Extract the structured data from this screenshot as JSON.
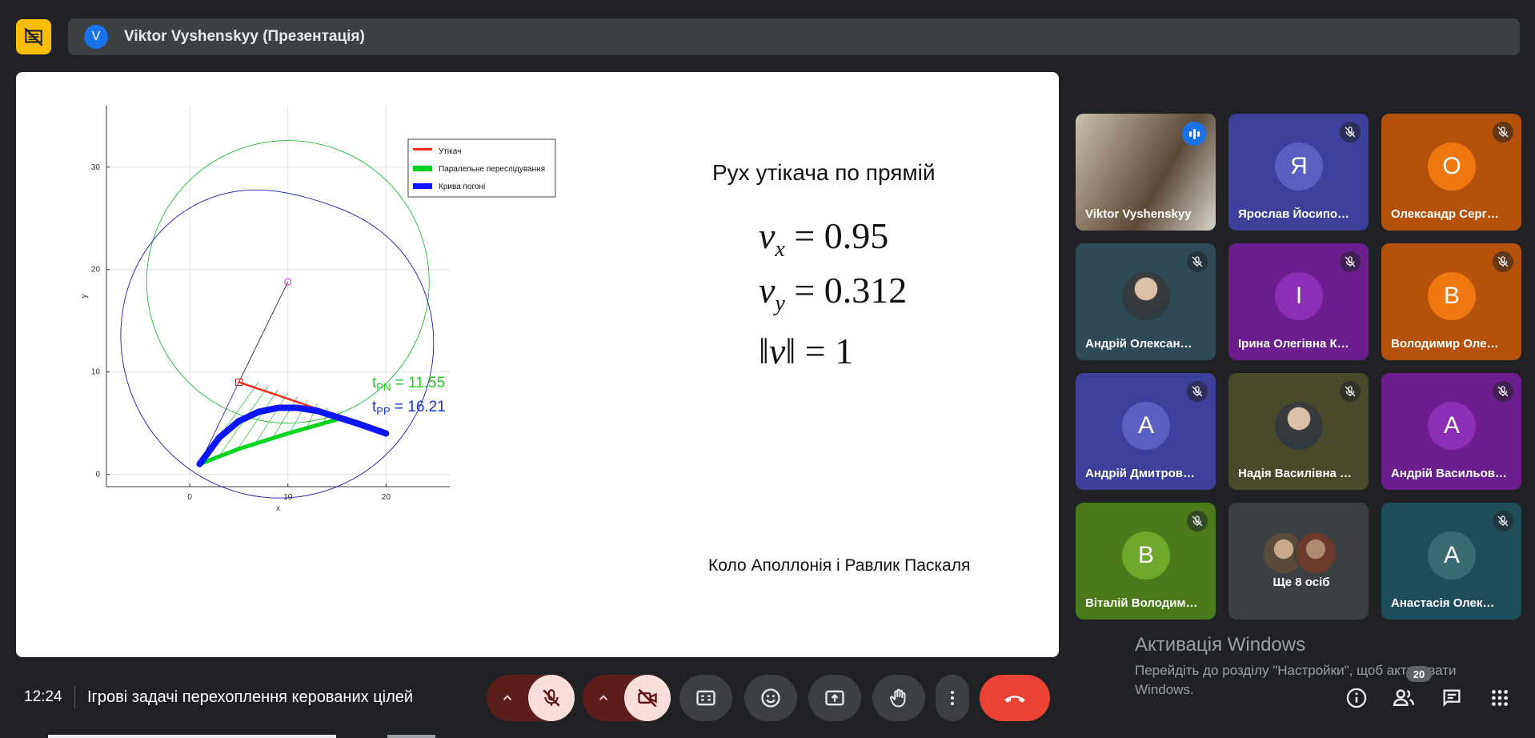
{
  "presenter": {
    "initial": "V",
    "title": "Viktor Vyshenskyy (Презентація)"
  },
  "slide": {
    "title": "Рух утікача по прямій",
    "caption": "Коло Аполлонія і Равлик Паскаля",
    "formulas": [
      {
        "var": "v",
        "sub": "x",
        "rhs": "= 0.95"
      },
      {
        "var": "v",
        "sub": "y",
        "rhs": "= 0.312"
      },
      {
        "norm": "v",
        "rhs": "= 1"
      }
    ]
  },
  "chart_data": {
    "type": "line",
    "xlabel": "x",
    "ylabel": "y",
    "xticks": [
      "0",
      "10",
      "20"
    ],
    "yticks": [
      "0",
      "10",
      "20",
      "30"
    ],
    "xlim": [
      -8.5,
      26.5
    ],
    "ylim": [
      -1.2,
      36
    ],
    "grid": true,
    "legend_position": "top-right",
    "series": [
      {
        "name": "Утікач",
        "color": "#ff2a1a",
        "x": [
          5,
          9,
          13
        ],
        "y": [
          9,
          7.7,
          6.4
        ]
      },
      {
        "name": "Паралельне переслідування",
        "color": "#00d41e",
        "x": [
          1,
          5,
          10,
          15.5
        ],
        "y": [
          1,
          2.5,
          4,
          5.5
        ]
      },
      {
        "name": "Крива погоні",
        "color": "#0a14ff",
        "x": [
          1,
          3,
          5,
          7,
          9,
          11,
          13,
          15,
          17,
          20
        ],
        "y": [
          1,
          3.6,
          5.2,
          6.1,
          6.5,
          6.5,
          6.2,
          5.6,
          5.0,
          4.0
        ]
      }
    ],
    "annotations": [
      {
        "label": "t",
        "sub": "PN",
        "value": "= 11.55",
        "color": "#22cc22"
      },
      {
        "label": "t",
        "sub": "PP",
        "value": "= 16.21",
        "color": "#1a33cc"
      }
    ],
    "center_point": [
      10,
      18.8
    ],
    "start_point": [
      5,
      9
    ]
  },
  "participants": [
    {
      "name": "Viktor Vyshenskyy",
      "type": "video",
      "bg": "#7a6a58",
      "speaking": true
    },
    {
      "name": "Ярослав Йосипо…",
      "initial": "Я",
      "bg": "#3d3f9a",
      "avatar_bg": "#5b5fbf"
    },
    {
      "name": "Олександр Серг…",
      "initial": "О",
      "bg": "#b4520b",
      "avatar_bg": "#f07810"
    },
    {
      "name": "Андрій Олексан…",
      "type": "photo",
      "bg": "#2e4a54"
    },
    {
      "name": "Ірина Олегівна К…",
      "initial": "І",
      "bg": "#6b1f8f",
      "avatar_bg": "#8c2fb5"
    },
    {
      "name": "Володимир Оле…",
      "initial": "В",
      "bg": "#b4520b",
      "avatar_bg": "#f07810"
    },
    {
      "name": "Андрій Дмитров…",
      "initial": "А",
      "bg": "#3d3f9a",
      "avatar_bg": "#5b5fbf"
    },
    {
      "name": "Надія Василівна …",
      "type": "photo",
      "bg": "#4a4a2a"
    },
    {
      "name": "Андрій Васильов…",
      "initial": "А",
      "bg": "#6b1f8f",
      "avatar_bg": "#8c2fb5"
    },
    {
      "name": "Віталій Володим…",
      "initial": "В",
      "bg": "#4a7a1a",
      "avatar_bg": "#6ca82a"
    },
    {
      "name": "Ще 8 осіб",
      "type": "more",
      "bg": "#3c4043"
    },
    {
      "name": "Анастасія Олек…",
      "initial": "А",
      "bg": "#1f4e5a",
      "avatar_bg": "#3a6a74"
    }
  ],
  "watermark": {
    "title": "Активація Windows",
    "sub": "Перейдіть до розділу \"Настройки\", щоб активувати Windows."
  },
  "bottom": {
    "time": "12:24",
    "meeting_title": "Ігрові задачі перехоплення керованих цілей",
    "participant_count": "20"
  },
  "icons": {
    "mic": "mic-off-icon",
    "camera": "camera-off-icon",
    "captions": "captions-icon",
    "emoji": "emoji-icon",
    "present": "present-icon",
    "hand": "raise-hand-icon",
    "more": "more-vert-icon",
    "hangup": "hangup-icon",
    "info": "info-icon",
    "people": "people-icon",
    "chat": "chat-icon",
    "apps": "apps-icon"
  }
}
